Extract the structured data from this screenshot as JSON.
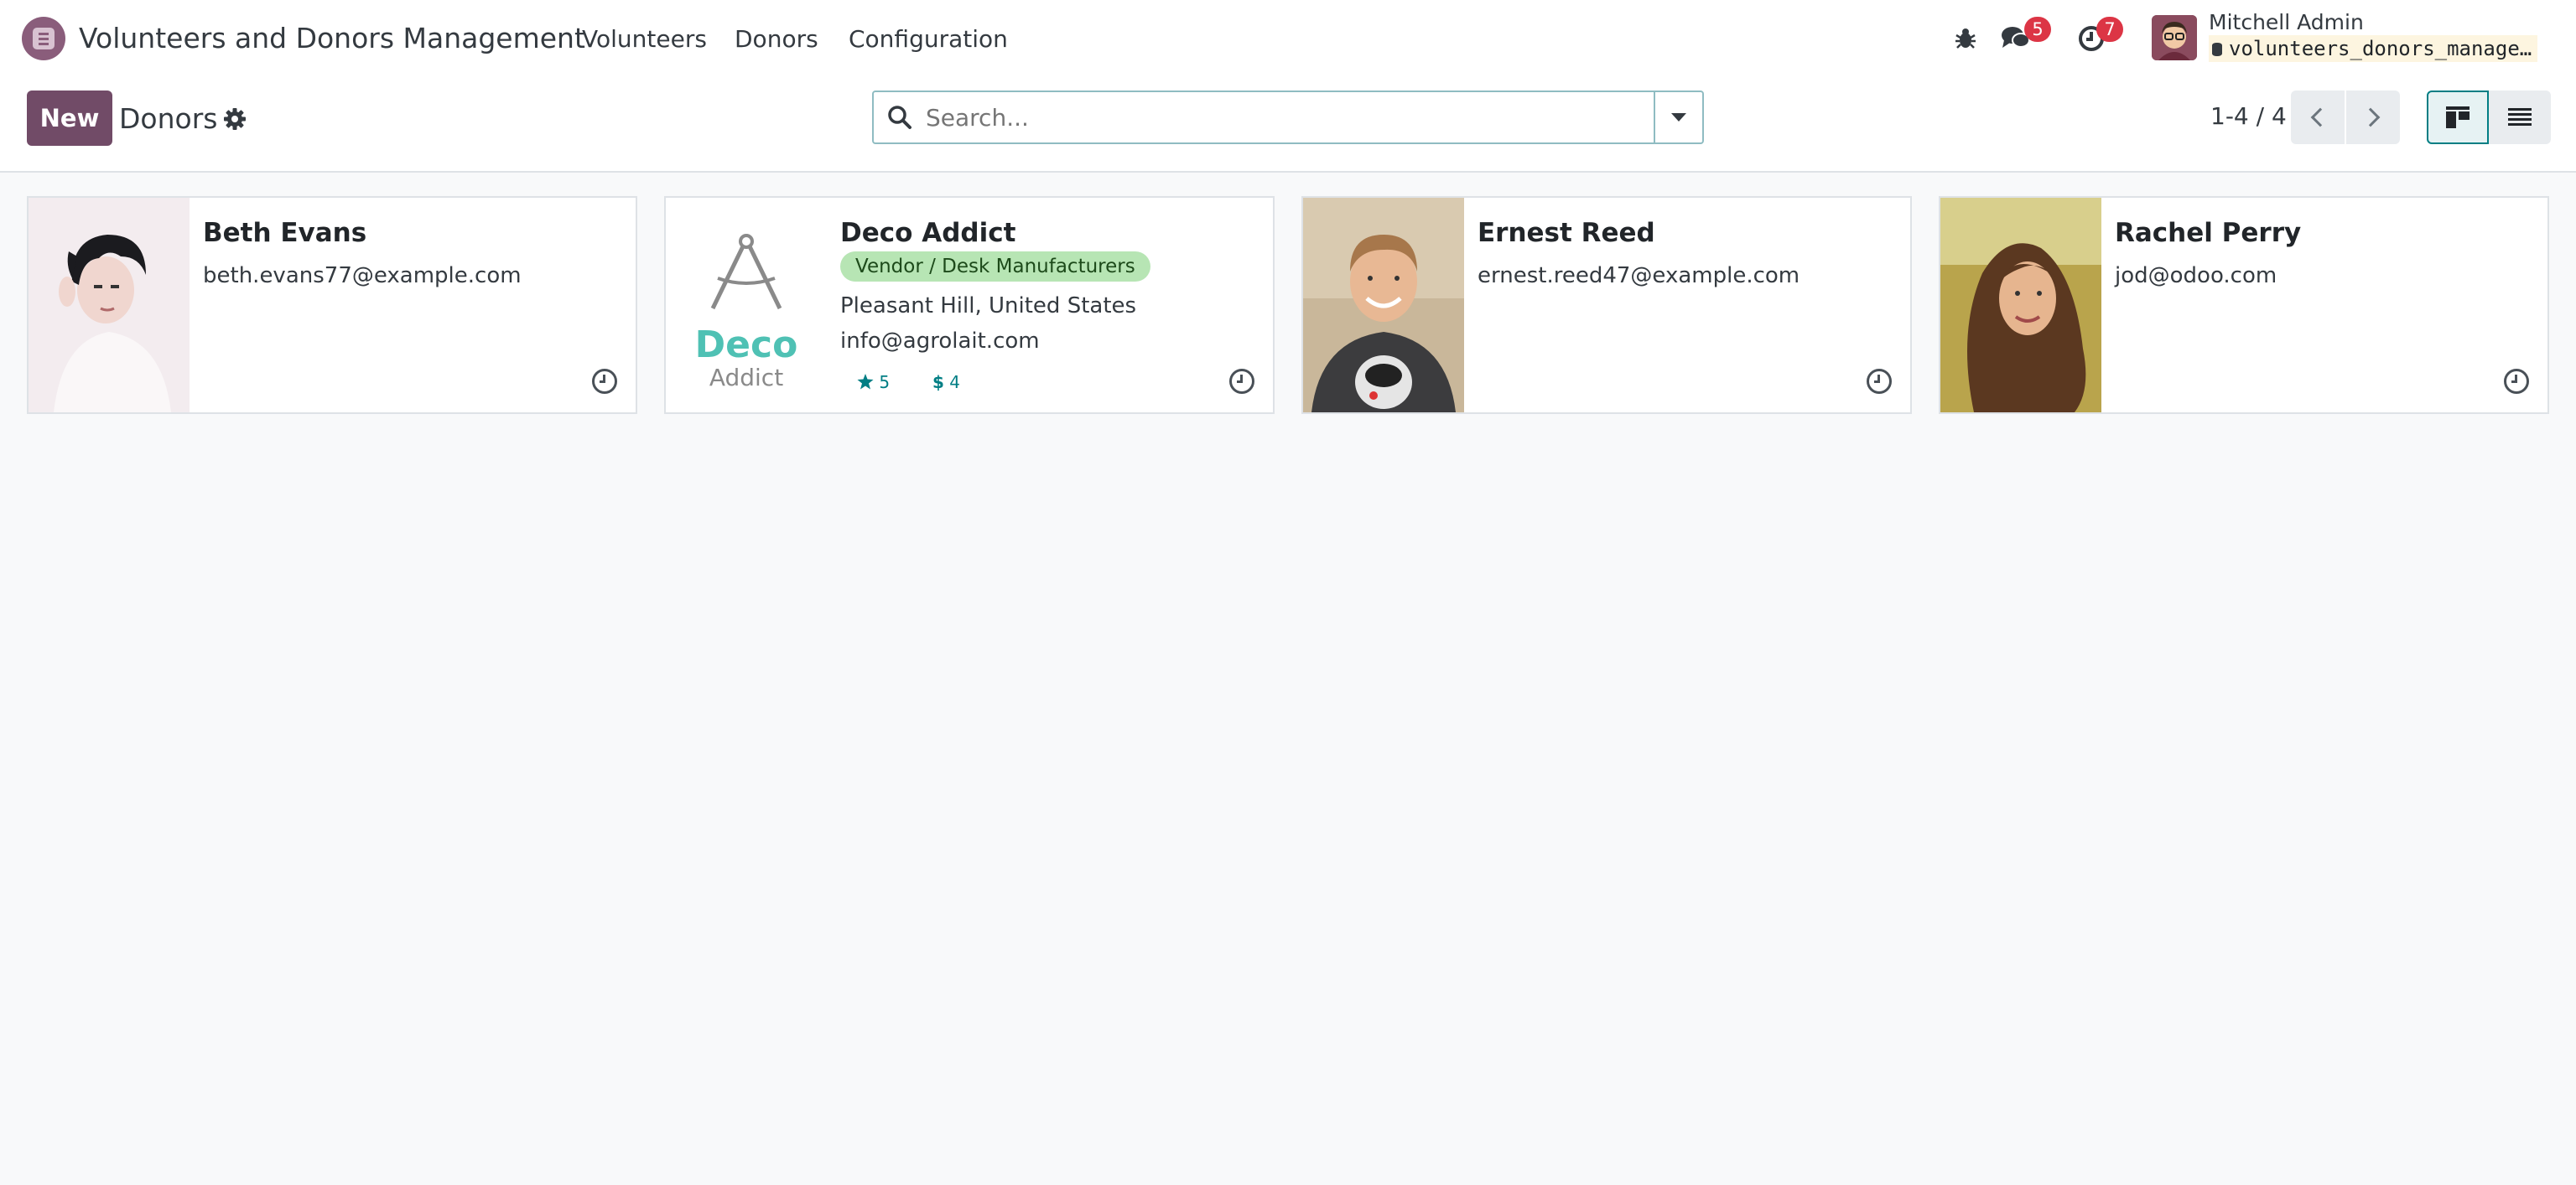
{
  "nav": {
    "app_name": "Volunteers and Donors Management",
    "menu": [
      "Volunteers",
      "Donors",
      "Configuration"
    ],
    "messages_count": "5",
    "activities_count": "7",
    "user_name": "Mitchell Admin",
    "database": "volunteers_donors_management"
  },
  "control": {
    "new_label": "New",
    "breadcrumb": "Donors",
    "search_placeholder": "Search...",
    "pager": "1-4 / 4"
  },
  "cards": [
    {
      "name": "Beth Evans",
      "email": "beth.evans77@example.com"
    },
    {
      "name": "Deco Addict",
      "tag": "Vendor / Desk Manufacturers",
      "address": "Pleasant Hill, United States",
      "email": "info@agrolait.com",
      "rating": "5",
      "amount": "4",
      "logo_main": "Deco",
      "logo_sub": "Addict"
    },
    {
      "name": "Ernest Reed",
      "email": "ernest.reed47@example.com"
    },
    {
      "name": "Rachel Perry",
      "email": "jod@odoo.com"
    }
  ],
  "colors": {
    "primary": "#714b67",
    "accent": "#017e84",
    "tag_bg": "#b7e5b4"
  }
}
